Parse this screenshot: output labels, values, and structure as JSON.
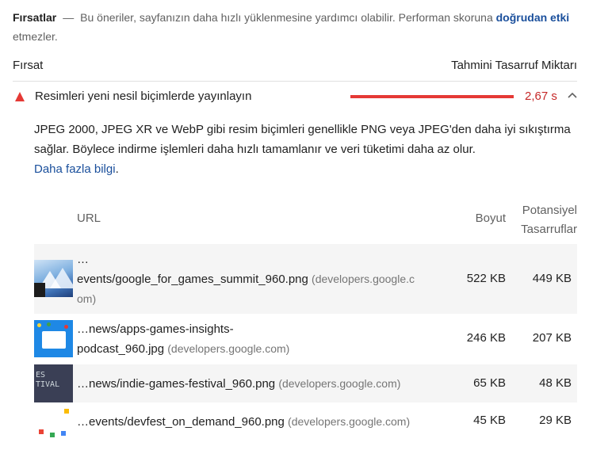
{
  "header": {
    "title": "Fırsatlar",
    "dash": "—",
    "text": "Bu öneriler, sayfanızın daha hızlı yüklenmesine yardımcı olabilir. Performan skoruna",
    "link": "doğrudan etki",
    "text_end": "etmezler."
  },
  "columns": {
    "left": "Fırsat",
    "right": "Tahmini Tasarruf Miktarı"
  },
  "audit": {
    "title": "Resimleri yeni nesil biçimlerde yayınlayın",
    "saving": "2,67 s",
    "status_color": "#e53935",
    "expanded": true
  },
  "description": {
    "text": "JPEG 2000, JPEG XR ve WebP gibi resim biçimleri genellikle PNG veya JPEG'den daha iyi sıkıştırma sağlar. Böylece indirme işlemleri daha hızlı tamamlanır ve veri tüketimi daha az olur.",
    "link": "Daha fazla bilgi",
    "link_suffix": "."
  },
  "table": {
    "headers": {
      "url": "URL",
      "size": "Boyut",
      "potential_line1": "Potansiyel",
      "potential_line2": "Tasarruflar"
    },
    "rows": [
      {
        "url_line1": "…",
        "url_line2": "events/google_for_games_summit_960.png",
        "domain_a": "(developers.google.c",
        "domain_b": "om)",
        "size": "522 KB",
        "potential": "449 KB"
      },
      {
        "url_line1": "…news/apps-games-insights-",
        "url_line2": "podcast_960.jpg",
        "domain": "(developers.google.com)",
        "size": "246 KB",
        "potential": "207 KB"
      },
      {
        "url": "…news/indie-games-festival_960.png",
        "domain": "(developers.google.com)",
        "size": "65 KB",
        "potential": "48 KB"
      },
      {
        "url": "…events/devfest_on_demand_960.png",
        "domain": "(developers.google.com)",
        "size": "45 KB",
        "potential": "29 KB"
      }
    ]
  }
}
